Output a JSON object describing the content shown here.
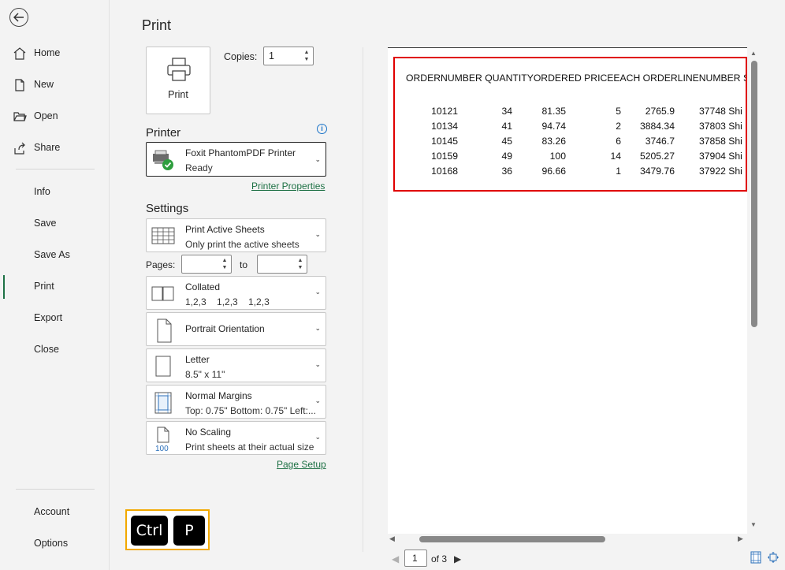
{
  "nav": {
    "items": [
      {
        "label": "Home",
        "icon": "home-icon"
      },
      {
        "label": "New",
        "icon": "new-document-icon"
      },
      {
        "label": "Open",
        "icon": "open-folder-icon"
      },
      {
        "label": "Share",
        "icon": "share-icon"
      },
      {
        "label": "Info"
      },
      {
        "label": "Save"
      },
      {
        "label": "Save As"
      },
      {
        "label": "Print"
      },
      {
        "label": "Export"
      },
      {
        "label": "Close"
      },
      {
        "label": "Account"
      },
      {
        "label": "Options"
      }
    ],
    "active": "Print"
  },
  "title": "Print",
  "print_button": {
    "label": "Print"
  },
  "copies": {
    "label": "Copies:",
    "value": "1"
  },
  "printer": {
    "heading": "Printer",
    "name": "Foxit PhantomPDF Printer",
    "status": "Ready",
    "properties_link": "Printer Properties"
  },
  "settings": {
    "heading": "Settings",
    "sheets": {
      "line1": "Print Active Sheets",
      "line2": "Only print the active sheets"
    },
    "pages": {
      "label": "Pages:",
      "to_label": "to",
      "from": "",
      "to": ""
    },
    "collation": {
      "line1": "Collated",
      "line2": "1,2,3    1,2,3    1,2,3"
    },
    "orientation": {
      "line1": "Portrait Orientation"
    },
    "paper": {
      "line1": "Letter",
      "line2": "8.5\" x 11\""
    },
    "margins": {
      "line1": "Normal Margins",
      "line2": "Top: 0.75\" Bottom: 0.75\" Left:..."
    },
    "scaling": {
      "line1": "No Scaling",
      "line2": "Print sheets at their actual size",
      "icon_text": "100"
    },
    "page_setup_link": "Page Setup"
  },
  "shortcut": {
    "key1": "Ctrl",
    "key2": "P"
  },
  "preview": {
    "header": "ORDERNUMBER QUANTITYORDERED PRICEEACH ORDERLINENUMBER SA",
    "rows": [
      [
        "10121",
        "34",
        "81.35",
        "5",
        "2765.9",
        "37748 Shi"
      ],
      [
        "10134",
        "41",
        "94.74",
        "2",
        "3884.34",
        "37803 Shi"
      ],
      [
        "10145",
        "45",
        "83.26",
        "6",
        "3746.7",
        "37858 Shi"
      ],
      [
        "10159",
        "49",
        "100",
        "14",
        "5205.27",
        "37904 Shi"
      ],
      [
        "10168",
        "36",
        "96.66",
        "1",
        "3479.76",
        "37922 Shi"
      ]
    ]
  },
  "pager": {
    "current": "1",
    "of_label": "of 3"
  },
  "colors": {
    "accent": "#1e7145",
    "highlight": "#e00000",
    "shortcut_border": "#f2a900"
  }
}
